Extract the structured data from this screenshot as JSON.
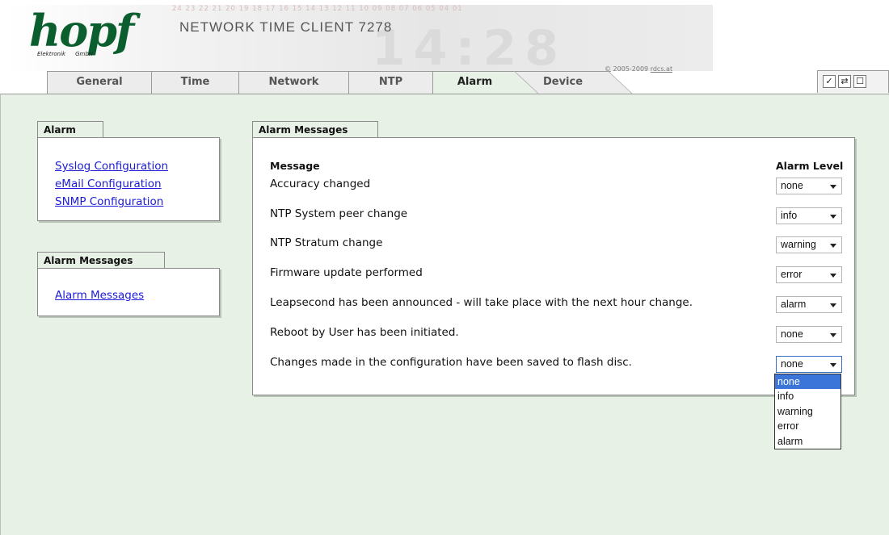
{
  "header": {
    "logo": "hopf",
    "logo_sub_left": "Elektronik",
    "logo_sub_right": "GmbH",
    "product": "NETWORK TIME CLIENT 7278",
    "digit_strip": "24 23 22 21 20 19 18 17 16 15 14 13 12 11 10 09 08 07 06 05 04 01",
    "big_clock": "14:28",
    "copyright_prefix": "© 2005-2009",
    "copyright_link": "rdcs.at"
  },
  "tabs": [
    "General",
    "Time",
    "Network",
    "NTP",
    "Alarm",
    "Device"
  ],
  "active_tab": "Alarm",
  "toolbar": {
    "icons": [
      "check-icon",
      "refresh-icon",
      "square-icon"
    ],
    "check_glyph": "✓",
    "refresh_glyph": "⇄",
    "square_glyph": "☐"
  },
  "sidebar": {
    "alarm_title": "Alarm",
    "alarm_links": [
      "Syslog Configuration",
      "eMail Configuration",
      "SNMP Configuration"
    ],
    "messages_title": "Alarm Messages",
    "messages_links": [
      "Alarm Messages"
    ]
  },
  "main": {
    "title": "Alarm Messages",
    "col_message": "Message",
    "col_level": "Alarm Level",
    "rows": [
      {
        "message": "Accuracy changed",
        "level": "none"
      },
      {
        "message": "NTP System peer change",
        "level": "info"
      },
      {
        "message": "NTP Stratum change",
        "level": "warning"
      },
      {
        "message": "Firmware update performed",
        "level": "error"
      },
      {
        "message": "Leapsecond has been announced - will take place with the next hour change.",
        "level": "alarm"
      },
      {
        "message": "Reboot by User has been initiated.",
        "level": "none"
      },
      {
        "message": "Changes made in the configuration have been saved to flash disc.",
        "level": "none"
      }
    ],
    "open_dropdown": {
      "options": [
        "none",
        "info",
        "warning",
        "error",
        "alarm"
      ],
      "selected": "none"
    }
  },
  "colors": {
    "content_bg": "#e7f1e6",
    "logo_green": "#0b5f2f",
    "link_blue": "#1b1bd8",
    "selected_option_bg": "#3b75d9"
  }
}
